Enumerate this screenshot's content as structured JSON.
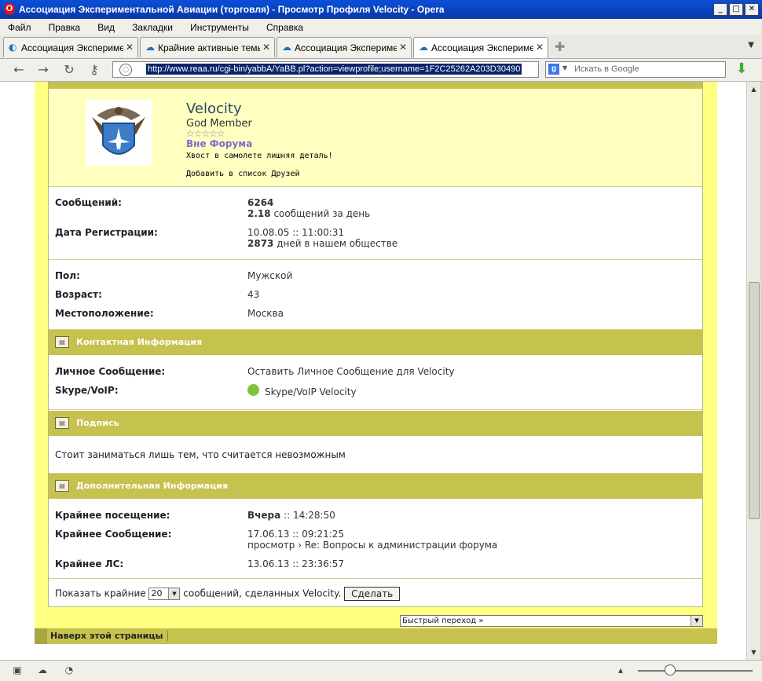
{
  "window": {
    "title": "Ассоциация Экспериментальной Авиации (торговля) - Просмотр Профиля Velocity - Opera",
    "buttons": [
      "_",
      "□",
      "✕"
    ]
  },
  "menu": [
    "Файл",
    "Правка",
    "Вид",
    "Закладки",
    "Инструменты",
    "Справка"
  ],
  "tabs": [
    {
      "label": "Ассоциация Эксперименталь..."
    },
    {
      "label": "Крайние активные темы"
    },
    {
      "label": "Ассоциация Эксперименталь..."
    },
    {
      "label": "Ассоциация Эксперименталь..."
    }
  ],
  "address": {
    "url": "http://www.reaa.ru/cgi-bin/yabbA/YaBB.pl?action=viewprofile;username=1F2C25262A203D30490",
    "search_placeholder": "Искать в Google"
  },
  "profile": {
    "username": "Velocity",
    "rank": "God Member",
    "stars": "☆☆☆☆☆",
    "status": "Вне Форума",
    "motto": "Хвост в самолете лишняя деталь!",
    "add_friend": "Добавить в список Друзей"
  },
  "stats": {
    "posts_label": "Сообщений:",
    "posts_count": "6264",
    "posts_per_day": "2.18",
    "posts_per_day_suffix": "сообщений за день",
    "reg_label": "Дата Регистрации:",
    "reg_date": "10.08.05 :: 11:00:31",
    "days_count": "2873",
    "days_suffix": "дней в нашем обществе"
  },
  "personal": {
    "gender_label": "Пол:",
    "gender": "Мужской",
    "age_label": "Возраст:",
    "age": "43",
    "location_label": "Местоположение:",
    "location": "Москва"
  },
  "contact": {
    "header": "Контактная Информация",
    "pm_label": "Личное Сообщение:",
    "pm_link": "Оставить Личное Сообщение для Velocity",
    "skype_label": "Skype/VoIP:",
    "skype_link": "Skype/VoIP Velocity"
  },
  "signature": {
    "header": "Подпись",
    "text": "Стоит заниматься лишь тем, что считается невозможным"
  },
  "extra": {
    "header": "Дополнительная Информация",
    "last_visit_label": "Крайнее посещение:",
    "last_visit_day": "Вчера",
    "last_visit_time": ":: 14:28:50",
    "last_post_label": "Крайнее Сообщение:",
    "last_post_time": "17.06.13 :: 09:21:25",
    "last_post_view": "просмотр",
    "last_post_topic": "Re: Вопросы к администрации форума",
    "last_pm_label": "Крайнее ЛС:",
    "last_pm_time": "13.06.13 :: 23:36:57"
  },
  "recent": {
    "prefix": "Показать крайние",
    "count": "20",
    "suffix": "сообщений, сделанных Velocity.",
    "button": "Сделать"
  },
  "quickjump": "Быстрый переход »",
  "back_to_top": "Наверх этой страницы"
}
